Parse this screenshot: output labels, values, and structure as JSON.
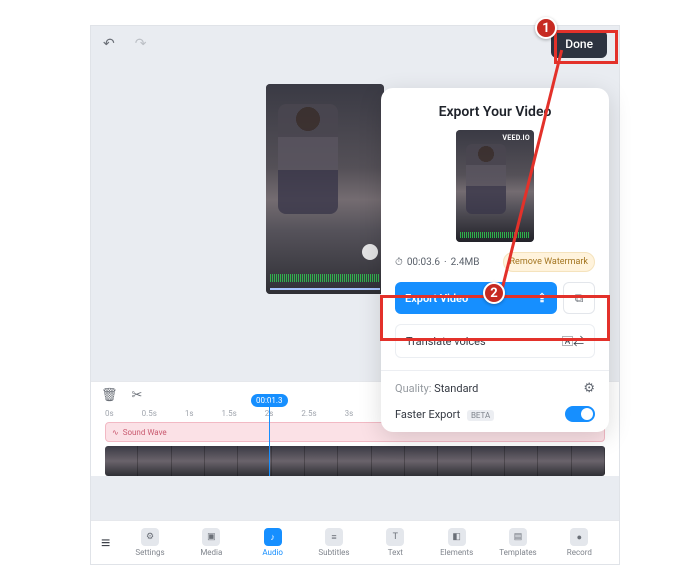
{
  "topbar": {
    "done": "Done"
  },
  "export": {
    "title": "Export Your Video",
    "brand": "VEED.IO",
    "duration": "00:03.6",
    "size": "2.4MB",
    "remove_watermark": "Remove Watermark",
    "export_btn": "Export Video",
    "translate": "Translate voices",
    "quality_label": "Quality:",
    "quality_value": "Standard",
    "faster_label": "Faster Export",
    "beta": "BETA"
  },
  "timeline": {
    "ticks": [
      "0s",
      "0.5s",
      "1s",
      "1.5s",
      "2s",
      "2.5s",
      "3s"
    ],
    "playhead": "00:01.3",
    "audio_track": "Sound Wave"
  },
  "nav": {
    "items": [
      {
        "label": "Settings",
        "icon": "⚙"
      },
      {
        "label": "Media",
        "icon": "▣"
      },
      {
        "label": "Audio",
        "icon": "♪"
      },
      {
        "label": "Subtitles",
        "icon": "≡"
      },
      {
        "label": "Text",
        "icon": "T"
      },
      {
        "label": "Elements",
        "icon": "◧"
      },
      {
        "label": "Templates",
        "icon": "▤"
      },
      {
        "label": "Record",
        "icon": "●"
      }
    ],
    "active_index": 2
  },
  "annotations": {
    "step1": "1",
    "step2": "2"
  }
}
